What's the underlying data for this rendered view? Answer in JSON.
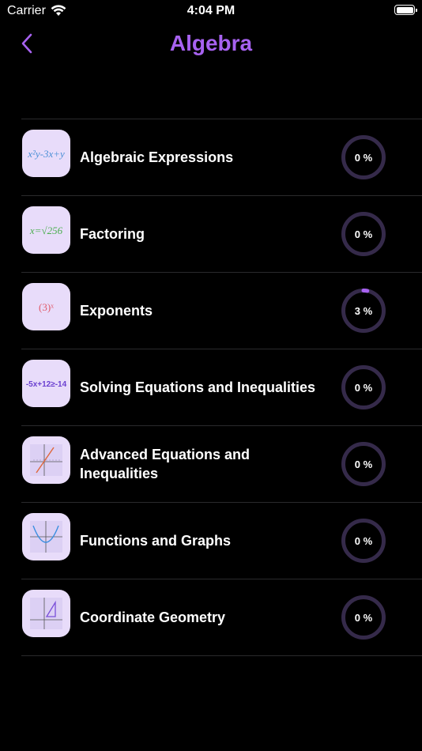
{
  "status_bar": {
    "carrier": "Carrier",
    "time": "4:04 PM"
  },
  "nav": {
    "title": "Algebra"
  },
  "colors": {
    "accent": "#a762f0",
    "ring_track": "#352a4a",
    "ring_fill": "#a762f0",
    "thumb_bg": "#e8dcfa"
  },
  "topics": [
    {
      "label": "Algebraic Expressions",
      "progress": "0 %",
      "progress_value": 0,
      "icon": "algebraic-expression-icon",
      "thumb_text": "x²y-3x+y"
    },
    {
      "label": "Factoring",
      "progress": "0 %",
      "progress_value": 0,
      "icon": "square-root-icon",
      "thumb_text": "x=√256"
    },
    {
      "label": "Exponents",
      "progress": "3 %",
      "progress_value": 3,
      "icon": "exponent-icon",
      "thumb_text": "(3)ˣ"
    },
    {
      "label": "Solving Equations and Inequalities",
      "progress": "0 %",
      "progress_value": 0,
      "icon": "inequality-icon",
      "thumb_text": "-5x+12≥-14"
    },
    {
      "label": "Advanced Equations and Inequalities",
      "progress": "0 %",
      "progress_value": 0,
      "icon": "line-graph-icon",
      "thumb_text": ""
    },
    {
      "label": "Functions and Graphs",
      "progress": "0 %",
      "progress_value": 0,
      "icon": "parabola-graph-icon",
      "thumb_text": ""
    },
    {
      "label": "Coordinate Geometry",
      "progress": "0 %",
      "progress_value": 0,
      "icon": "triangle-graph-icon",
      "thumb_text": ""
    }
  ]
}
